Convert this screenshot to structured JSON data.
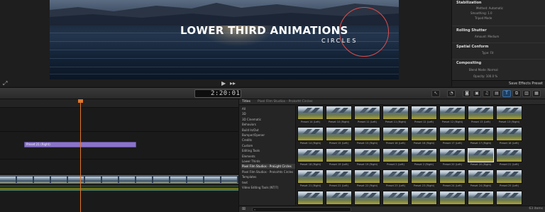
{
  "viewer": {
    "title_line1": "LOWER THIRD ANIMATIONS",
    "title_line2": "CIRCLES"
  },
  "inspector": {
    "sections": [
      {
        "title": "Stabilization",
        "rows": [
          "Method: Automatic",
          "Smoothing: 1.0",
          "Tripod Mode"
        ]
      },
      {
        "title": "Rolling Shutter",
        "rows": [
          "Amount: Medium"
        ]
      },
      {
        "title": "Spatial Conform",
        "rows": [
          "Type: Fit"
        ]
      },
      {
        "title": "Compositing",
        "rows": [
          "Blend Mode: Normal",
          "Opacity: 100.0 %"
        ]
      }
    ],
    "save_preset_label": "Save Effects Preset"
  },
  "toolbar": {
    "timecode": "2:20:01"
  },
  "timeline": {
    "title_clip_label": "Preset 21 (Right)"
  },
  "browser": {
    "header_label": "Titles",
    "breadcrumb": "Pixel Film Studios - Prolorht Circles",
    "categories": [
      "All",
      "3D",
      "3D Cinematic",
      "Behaviors",
      "Build In/Out",
      "Bumper/Opener",
      "Credits",
      "Custom",
      "Editing Tools",
      "Elements",
      "Lower Thirds",
      "Pixel Film Studios - ProLight Circles",
      "Pixel Film Studios - Proloirhts Circles",
      "Templates",
      "text",
      "Video Editing Tools (NT/7)"
    ],
    "selected_category": "Pixel Film Studios - ProLight Circles",
    "tiles": [
      "Preset 14 (Left)",
      "Preset 10 (Right)",
      "Preset 11 (Left)",
      "Preset 11 (Right)",
      "Preset 12 (Left)",
      "Preset 12 (Right)",
      "Preset 13 (Left)",
      "Preset 13 (Right)",
      "Preset 14 (Right)",
      "Preset 15 (Left)",
      "Preset 15 (Right)",
      "Preset 16 (Left)",
      "Preset 16 (Right)",
      "Preset 17 (Left)",
      "Preset 17 (Right)",
      "Preset 18 (Left)",
      "Preset 18 (Right)",
      "Preset 19 (Left)",
      "Preset 19 (Right)",
      "Preset 2 (Left)",
      "Preset 2 (Right)",
      "Preset 20 (Left)",
      "Preset 20 (Right)",
      "Preset 21 (Left)",
      "Preset 21 (Right)",
      "Preset 22 (Left)",
      "Preset 22 (Right)",
      "Preset 23 (Left)",
      "Preset 23 (Right)",
      "Preset 24 (Left)",
      "Preset 24 (Right)",
      "Preset 25 (Left)",
      "Preset 25 (Right)",
      "Preset 26 (Left)",
      "Preset 26 (Right)",
      "Preset 27 (Left)",
      "Preset 27 (Right)",
      "Preset 28 (Left)",
      "Preset 28 (Right)",
      "Preset 29 (Left)"
    ],
    "selected_tile": "Preset 20 (Right)",
    "item_count": "63 items"
  }
}
